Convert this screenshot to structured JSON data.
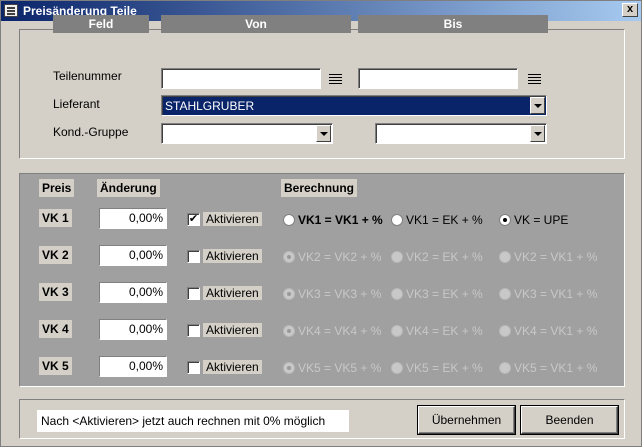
{
  "window": {
    "title": "Preisänderung Teile",
    "close_label": "x"
  },
  "filter": {
    "headers": {
      "feld": "Feld",
      "von": "Von",
      "bis": "Bis"
    },
    "rows": {
      "teilenummer": "Teilenummer",
      "lieferant": "Lieferant",
      "kond_gruppe": "Kond.-Gruppe"
    },
    "values": {
      "teilenummer_von": "",
      "teilenummer_bis": "",
      "lieferant_von": "STAHLGRUBER",
      "kond_von": "",
      "kond_bis": ""
    }
  },
  "pricing": {
    "headers": {
      "preis": "Preis",
      "aenderung": "Änderung",
      "berechnung": "Berechnung"
    },
    "activate_label": "Aktivieren",
    "rows": [
      {
        "label": "VK 1",
        "value": "0,00%",
        "checked": true,
        "check_glyph": "✔",
        "options": [
          "VK1 = VK1 + %",
          "VK1 = EK + %",
          "VK = UPE"
        ],
        "selected": 2,
        "enabled": true
      },
      {
        "label": "VK 2",
        "value": "0,00%",
        "checked": false,
        "check_glyph": "",
        "options": [
          "VK2 = VK2 + %",
          "VK2 = EK + %",
          "VK2 = VK1 + %"
        ],
        "selected": 0,
        "enabled": false
      },
      {
        "label": "VK 3",
        "value": "0,00%",
        "checked": false,
        "check_glyph": "",
        "options": [
          "VK3 = VK3 + %",
          "VK3 = EK + %",
          "VK3 = VK1 + %"
        ],
        "selected": 0,
        "enabled": false
      },
      {
        "label": "VK 4",
        "value": "0,00%",
        "checked": false,
        "check_glyph": "",
        "options": [
          "VK4 = VK4 + %",
          "VK4 = EK + %",
          "VK4 = VK1 + %"
        ],
        "selected": 0,
        "enabled": false
      },
      {
        "label": "VK 5",
        "value": "0,00%",
        "checked": false,
        "check_glyph": "",
        "options": [
          "VK5 = VK5 + %",
          "VK5 = EK + %",
          "VK5 = VK1 + %"
        ],
        "selected": 0,
        "enabled": false
      }
    ]
  },
  "footer": {
    "info": "Nach <Aktivieren> jetzt auch rechnen mit 0% möglich",
    "apply_label": "Übernehmen",
    "close_label": "Beenden"
  }
}
